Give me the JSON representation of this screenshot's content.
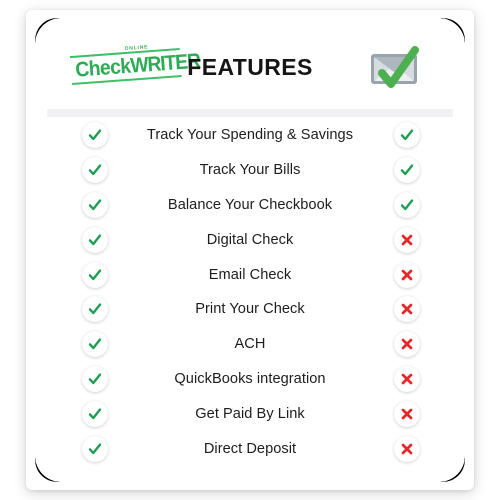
{
  "card": {
    "corner_accent_color": "#000000",
    "background": "#ffffff",
    "divider_color": "#f1f1f3"
  },
  "header": {
    "logo": {
      "name": "online-check-writer-logo",
      "tagline": "ONLINE",
      "text_main": "Check",
      "text_accent": "WRITER",
      "color": "#2eab57"
    },
    "title": "FEATURES",
    "icon": {
      "name": "check-approved-icon",
      "check_color": "#4cb050",
      "body_color": "#8f9aa6"
    }
  },
  "columns": {
    "left_name": "included-left",
    "right_name": "included-right"
  },
  "icons": {
    "check_label": "check-icon",
    "cross_label": "cross-icon",
    "check_color": "#1e9e52",
    "cross_color": "#e8262a"
  },
  "rows": [
    {
      "label": "Track Your Spending & Savings",
      "left": "check",
      "right": "check"
    },
    {
      "label": "Track Your Bills",
      "left": "check",
      "right": "check"
    },
    {
      "label": "Balance Your Checkbook",
      "left": "check",
      "right": "check"
    },
    {
      "label": "Digital Check",
      "left": "check",
      "right": "cross"
    },
    {
      "label": "Email Check",
      "left": "check",
      "right": "cross"
    },
    {
      "label": "Print Your Check",
      "left": "check",
      "right": "cross"
    },
    {
      "label": "ACH",
      "left": "check",
      "right": "cross"
    },
    {
      "label": "QuickBooks integration",
      "left": "check",
      "right": "cross"
    },
    {
      "label": "Get Paid By Link",
      "left": "check",
      "right": "cross"
    },
    {
      "label": "Direct Deposit",
      "left": "check",
      "right": "cross"
    }
  ]
}
